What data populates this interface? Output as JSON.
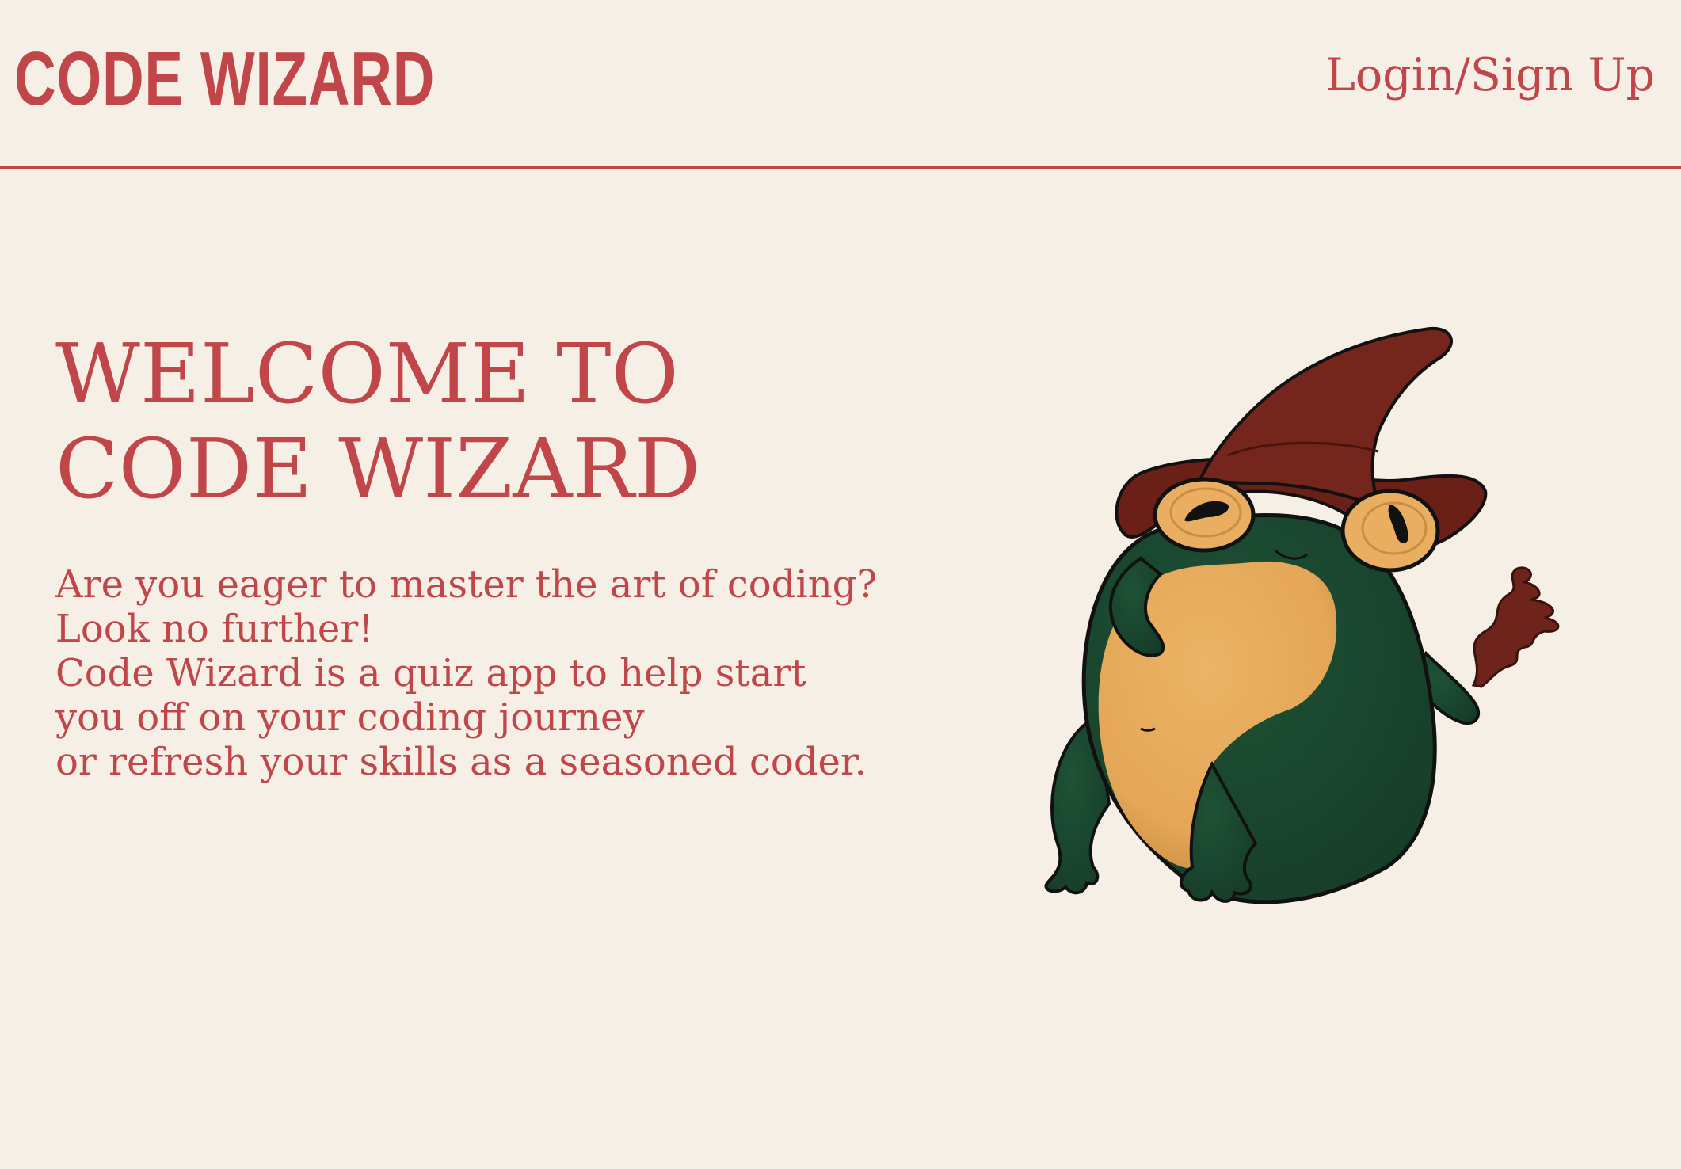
{
  "header": {
    "brand": "CODE WIZARD",
    "login_label": "Login/Sign Up"
  },
  "hero": {
    "title_lines": [
      "WELCOME TO",
      "CODE WIZARD"
    ],
    "body_lines": [
      "Are you eager to master the art of coding?",
      "Look no further!",
      "Code Wizard is a quiz app to help start",
      "you off on your coding journey",
      "or refresh your skills as a seasoned coder."
    ]
  },
  "mascot": {
    "icon": "wizard-frog-illustration"
  },
  "colors": {
    "accent": "#c0464a",
    "background": "#f5efe5",
    "frog_green": "#1c4a30",
    "frog_belly": "#e9ae5f",
    "hat": "#6e231b"
  }
}
